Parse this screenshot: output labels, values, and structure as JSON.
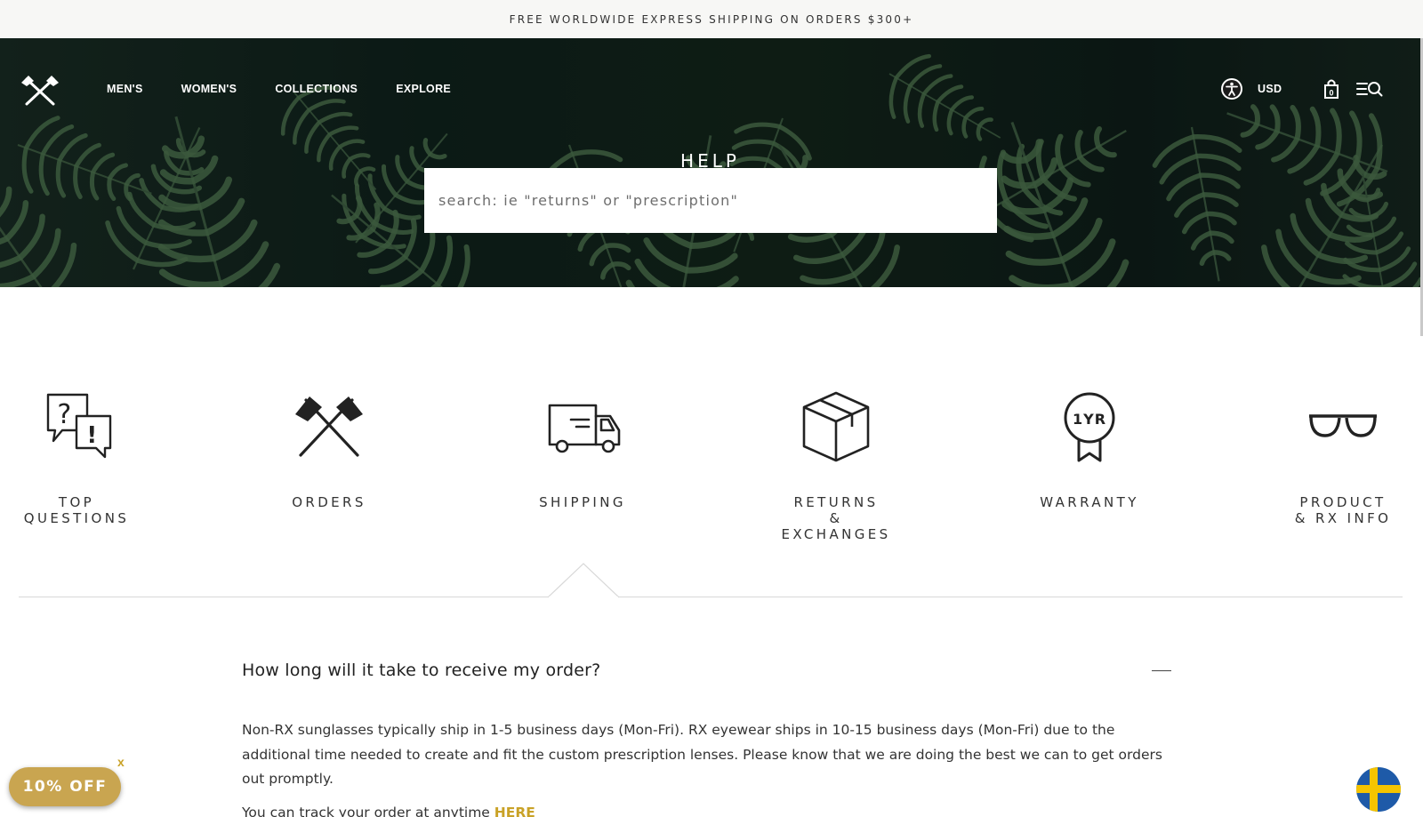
{
  "announcement": "FREE WORLDWIDE EXPRESS SHIPPING ON ORDERS $300+",
  "nav": {
    "items": [
      "MEN'S",
      "WOMEN'S",
      "COLLECTIONS",
      "EXPLORE"
    ],
    "currency": "USD",
    "cart_count": "0"
  },
  "hero": {
    "title": "HELP",
    "search_placeholder": "search: ie \"returns\" or \"prescription\""
  },
  "categories": [
    {
      "label": "TOP\nQUESTIONS",
      "icon": "chat-bubbles-icon"
    },
    {
      "label": "ORDERS",
      "icon": "crossed-axes-icon"
    },
    {
      "label": "SHIPPING",
      "icon": "delivery-truck-icon"
    },
    {
      "label": "RETURNS\n&\nEXCHANGES",
      "icon": "box-icon"
    },
    {
      "label": "WARRANTY",
      "icon": "ribbon-badge-icon",
      "badge_text": "1YR"
    },
    {
      "label": "PRODUCT\n& RX INFO",
      "icon": "sunglasses-icon"
    }
  ],
  "selected_category": "SHIPPING",
  "faq": {
    "question": "How long will it take to receive my order?",
    "answer": "Non-RX sunglasses typically ship in 1-5 business days (Mon-Fri).  RX eyewear ships in 10-15 business days (Mon-Fri) due to the additional time needed to create and fit the custom prescription lenses. Please know that we are doing the best we can to get orders out promptly.",
    "track_text": "You can track your order at anytime ",
    "track_link": "HERE"
  },
  "promo": {
    "label": "10% OFF",
    "close": "x"
  },
  "colors": {
    "accent_gold": "#c9a227",
    "promo_bg": "#c9a550"
  }
}
